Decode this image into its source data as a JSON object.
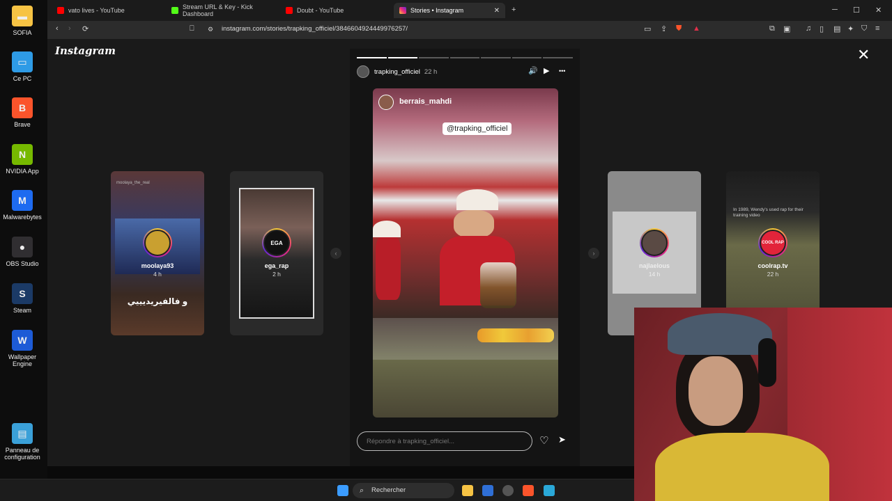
{
  "desktop": {
    "icons": [
      {
        "label": "SOFIA",
        "color": "#f6c344",
        "glyph": "▬"
      },
      {
        "label": "Ce PC",
        "color": "#2e9be6",
        "glyph": "▭"
      },
      {
        "label": "Brave",
        "color": "#fb542b",
        "glyph": "B"
      },
      {
        "label": "NVIDIA App",
        "color": "#76b900",
        "glyph": "N"
      },
      {
        "label": "Malwarebytes",
        "color": "#1e6bf0",
        "glyph": "M"
      },
      {
        "label": "OBS Studio",
        "color": "#302e31",
        "glyph": "●"
      },
      {
        "label": "Steam",
        "color": "#1b3a66",
        "glyph": "S"
      },
      {
        "label": "Wallpaper Engine",
        "color": "#1d5bd6",
        "glyph": "W"
      },
      {
        "label": "Panneau de configuration",
        "color": "#3aa0d8",
        "glyph": "▤"
      }
    ]
  },
  "browser": {
    "tabs": [
      {
        "label": "vato lives - YouTube",
        "color": "#ff0000",
        "active": false
      },
      {
        "label": "Stream URL & Key - Kick Dashboard",
        "color": "#53fc18",
        "active": false
      },
      {
        "label": "Doubt - YouTube",
        "color": "#ff0000",
        "active": false
      },
      {
        "label": "Stories • Instagram",
        "color": "#e1306c",
        "active": true
      }
    ],
    "new_tab": "+",
    "url": "instagram.com/stories/trapking_officiel/3846604924449976257/",
    "window": {
      "minimize": "─",
      "maximize": "☐",
      "close": "✕"
    }
  },
  "instagram": {
    "logo": "Instagram",
    "close": "✕",
    "story": {
      "progress_total": 7,
      "progress_done": 2,
      "username": "trapking_officiel",
      "time": "22 h",
      "photo_user": "berrais_mahdi",
      "photo_tag": "@trapking_officiel",
      "reply_placeholder": "Répondre à trapking_officiel...",
      "mute_icon": "🔊",
      "play_icon": "▶",
      "more_icon": "•••",
      "heart_icon": "♡",
      "share_icon": "➤"
    },
    "previews": [
      {
        "name": "moolaya93",
        "time": "4 h",
        "caption": "و فالفيريديييي",
        "top_text": "moolaya_the_real",
        "ring_label": ""
      },
      {
        "name": "ega_rap",
        "time": "2 h",
        "caption": "",
        "top_text": "",
        "ring_label": "EGA"
      },
      {
        "name": "najlaelous",
        "time": "14 h",
        "caption": "",
        "top_text": "",
        "ring_label": ""
      },
      {
        "name": "coolrap.tv",
        "time": "22 h",
        "caption": "",
        "top_text": "In 1989, Wendy's used rap for their training video",
        "ring_label": "COOL RAP"
      }
    ],
    "arrows": {
      "left": "‹",
      "right": "›"
    }
  },
  "taskbar": {
    "search": "Rechercher",
    "start_color": "#3b9cff"
  }
}
